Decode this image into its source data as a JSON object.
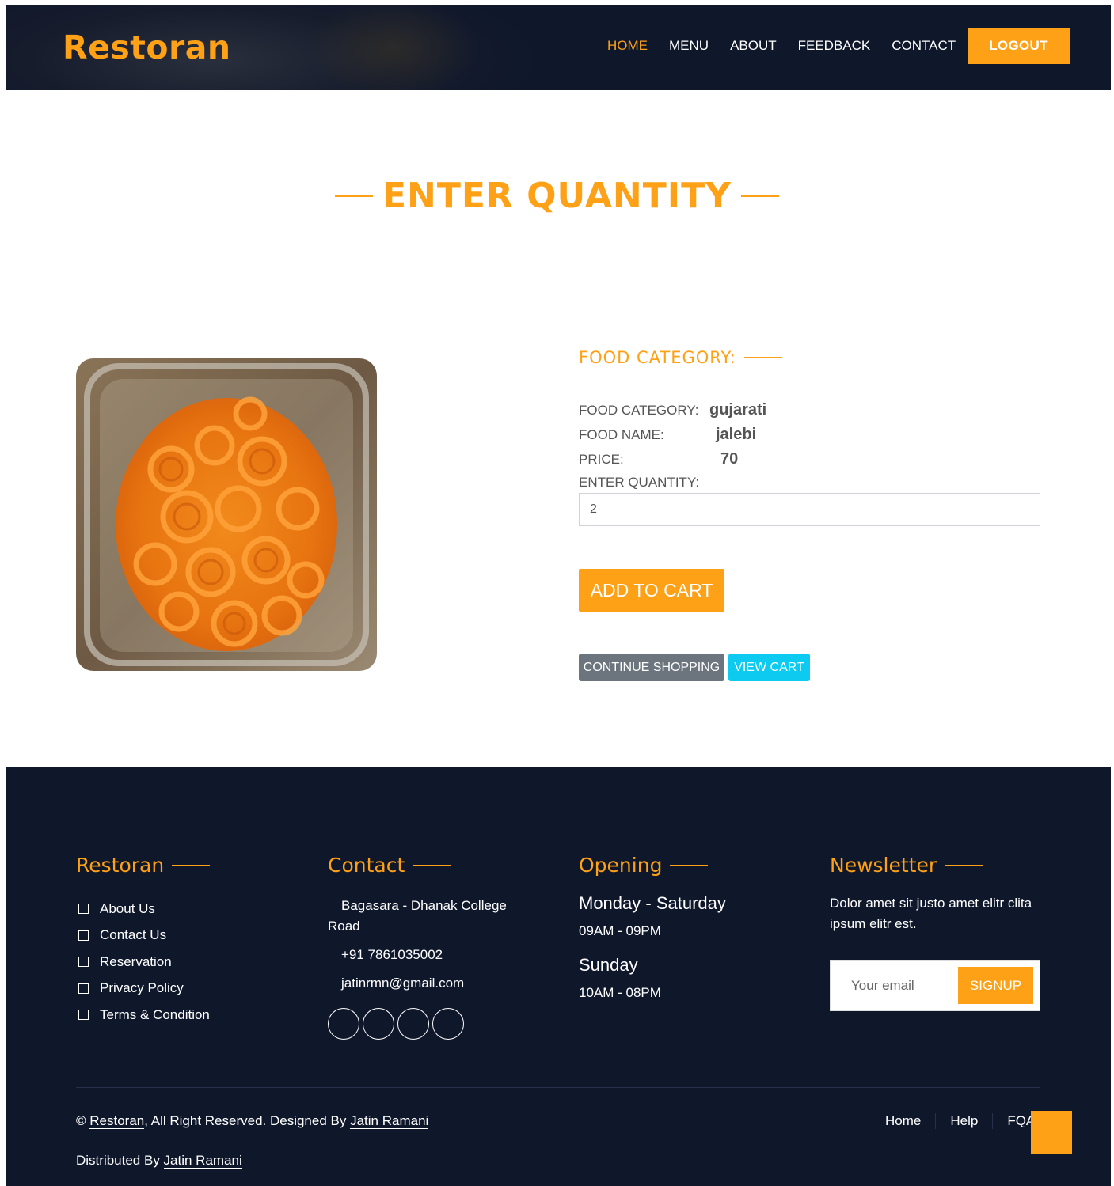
{
  "brand": {
    "logo": "Restoran",
    "accent_color": "#fea116",
    "dark_color": "#0f172b"
  },
  "nav": {
    "items": [
      {
        "label": "HOME",
        "active": true
      },
      {
        "label": "MENU"
      },
      {
        "label": "ABOUT"
      },
      {
        "label": "FEEDBACK"
      },
      {
        "label": "CONTACT"
      }
    ],
    "logout_label": "LOGOUT"
  },
  "page": {
    "title": "ENTER QUANTITY"
  },
  "product": {
    "section_heading": "FOOD CATEGORY:",
    "category_label": "FOOD CATEGORY:",
    "category_value": "gujarati",
    "name_label": "FOOD NAME:",
    "name_value": "jalebi",
    "price_label": "PRICE:",
    "price_value": "70",
    "quantity_label": "ENTER QUANTITY:",
    "quantity_value": "2",
    "add_to_cart_label": "ADD TO CART",
    "continue_shopping_label": "CONTINUE SHOPPING",
    "view_cart_label": "VIEW CART"
  },
  "footer": {
    "restoran": {
      "heading": "Restoran",
      "links": [
        "About Us",
        "Contact Us",
        "Reservation",
        "Privacy Policy",
        "Terms & Condition"
      ]
    },
    "contact": {
      "heading": "Contact",
      "address_line1": "Bagasara - Dhanak College",
      "address_line2": "Road",
      "phone": "+91 7861035002",
      "email": "jatinrmn@gmail.com"
    },
    "opening": {
      "heading": "Opening",
      "day1": "Monday - Saturday",
      "time1": "09AM - 09PM",
      "day2": "Sunday",
      "time2": "10AM - 08PM"
    },
    "newsletter": {
      "heading": "Newsletter",
      "text_line1": "Dolor amet sit justo amet elitr clita",
      "text_line2": "ipsum elitr est.",
      "email_placeholder": "Your email",
      "signup_label": "SIGNUP"
    },
    "copyright_prefix": "© ",
    "copyright_brand": "Restoran",
    "copyright_middle": ", All Right Reserved. Designed By ",
    "copyright_author": "Jatin Ramani",
    "distributed_prefix": "Distributed By ",
    "distributed_author": "Jatin Ramani",
    "menu": [
      "Home",
      "Help",
      "FQA"
    ]
  }
}
